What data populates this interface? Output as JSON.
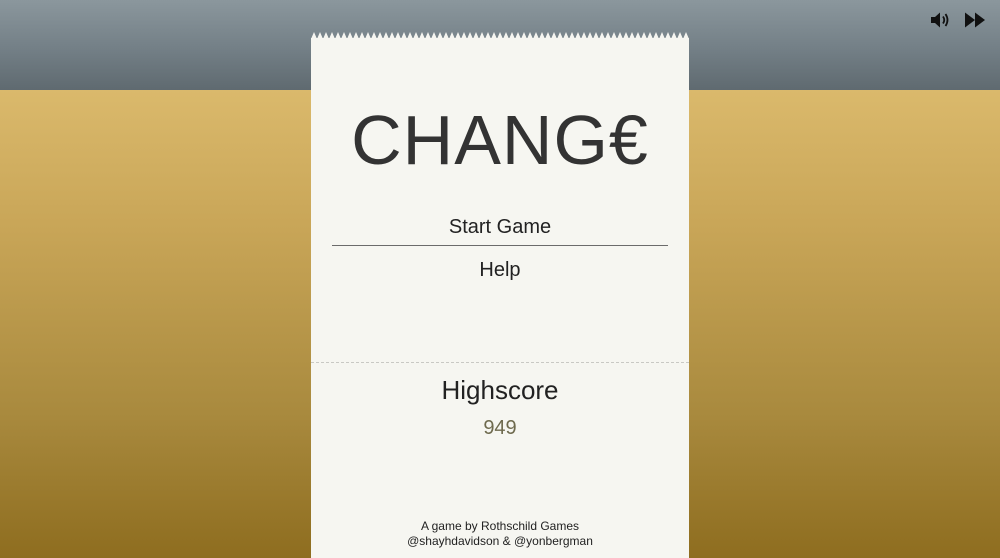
{
  "game": {
    "title": "CHANG€",
    "menu": {
      "start_label": "Start Game",
      "help_label": "Help"
    },
    "highscore": {
      "label": "Highscore",
      "value": "949"
    },
    "credits": {
      "line1": "A game by Rothschild Games",
      "line2": "@shayhdavidson & @yonbergman"
    }
  },
  "controls": {
    "sound_icon": "speaker-icon",
    "skip_icon": "fast-forward-icon"
  },
  "colors": {
    "top_band": "#737f86",
    "background_gold": "#c9a658",
    "receipt_paper": "#f6f6f1",
    "highscore_value": "#6e6a4e"
  }
}
